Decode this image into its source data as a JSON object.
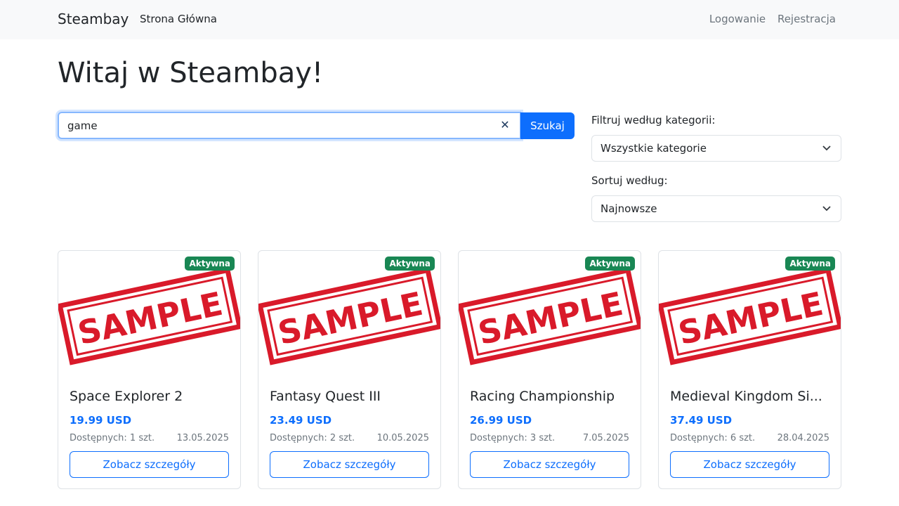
{
  "navbar": {
    "brand": "Steambay",
    "home": "Strona Główna",
    "login": "Logowanie",
    "register": "Rejestracja"
  },
  "page_title": "Witaj w Steambay!",
  "search": {
    "value": "game",
    "clear_icon": "✕",
    "button": "Szukaj"
  },
  "filters": {
    "category_label": "Filtruj według kategorii:",
    "category_value": "Wszystkie kategorie",
    "sort_label": "Sortuj według:",
    "sort_value": "Najnowsze"
  },
  "cards": [
    {
      "badge": "Aktywna",
      "image_text": "SAMPLE",
      "title": "Space Explorer 2",
      "price": "19.99 USD",
      "stock": "Dostępnych: 1 szt.",
      "date": "13.05.2025",
      "button": "Zobacz szczegóły"
    },
    {
      "badge": "Aktywna",
      "image_text": "SAMPLE",
      "title": "Fantasy Quest III",
      "price": "23.49 USD",
      "stock": "Dostępnych: 2 szt.",
      "date": "10.05.2025",
      "button": "Zobacz szczegóły"
    },
    {
      "badge": "Aktywna",
      "image_text": "SAMPLE",
      "title": "Racing Championship",
      "price": "26.99 USD",
      "stock": "Dostępnych: 3 szt.",
      "date": "7.05.2025",
      "button": "Zobacz szczegóły"
    },
    {
      "badge": "Aktywna",
      "image_text": "SAMPLE",
      "title": "Medieval Kingdom Si...",
      "price": "37.49 USD",
      "stock": "Dostępnych: 6 szt.",
      "date": "28.04.2025",
      "button": "Zobacz szczegóły"
    }
  ],
  "colors": {
    "primary": "#0d6efd",
    "success": "#198754",
    "stamp_red": "#d91a2a",
    "navbar_bg": "#f8f9fa"
  }
}
